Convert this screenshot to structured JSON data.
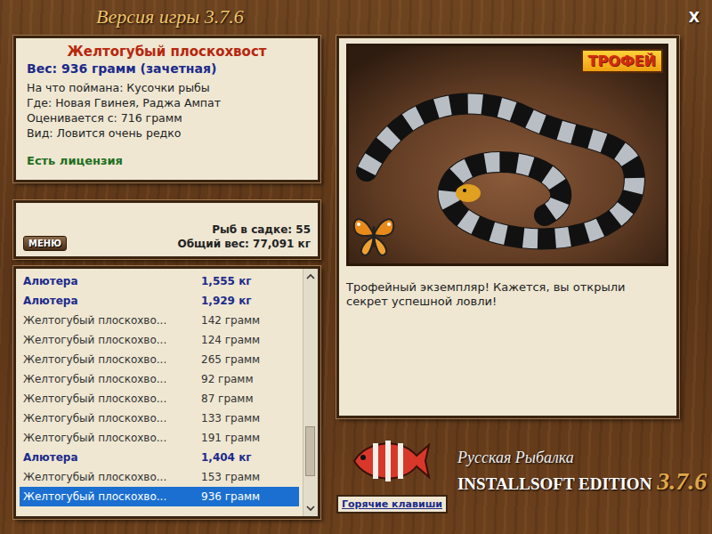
{
  "window": {
    "title": "Версия игры 3.7.6",
    "close": "X"
  },
  "catch": {
    "name": "Желтогубый плоскохвост",
    "weight": "Вес: 936 грамм (зачетная)",
    "details": [
      "На что поймана: Кусочки рыбы",
      "Где: Новая Гвинея, Раджа Ампат",
      "Оценивается с: 716 грамм",
      "Вид: Ловится очень редко"
    ],
    "license": "Есть лицензия"
  },
  "keepnet": {
    "menu_button": "МЕНЮ",
    "count": "Рыб в садке: 55",
    "total": "Общий вес: 77,091 кг"
  },
  "list": [
    {
      "name": "Алютера",
      "weight": "1,555 кг",
      "highlighted": true,
      "selected": false
    },
    {
      "name": "Алютера",
      "weight": "1,929 кг",
      "highlighted": true,
      "selected": false
    },
    {
      "name": "Желтогубый плоскохво...",
      "weight": "142 грамм",
      "highlighted": false,
      "selected": false
    },
    {
      "name": "Желтогубый плоскохво...",
      "weight": "124 грамм",
      "highlighted": false,
      "selected": false
    },
    {
      "name": "Желтогубый плоскохво...",
      "weight": "265 грамм",
      "highlighted": false,
      "selected": false
    },
    {
      "name": "Желтогубый плоскохво...",
      "weight": "92 грамм",
      "highlighted": false,
      "selected": false
    },
    {
      "name": "Желтогубый плоскохво...",
      "weight": "87 грамм",
      "highlighted": false,
      "selected": false
    },
    {
      "name": "Желтогубый плоскохво...",
      "weight": "133 грамм",
      "highlighted": false,
      "selected": false
    },
    {
      "name": "Желтогубый плоскохво...",
      "weight": "191 грамм",
      "highlighted": false,
      "selected": false
    },
    {
      "name": "Алютера",
      "weight": "1,404 кг",
      "highlighted": true,
      "selected": false
    },
    {
      "name": "Желтогубый плоскохво...",
      "weight": "153 грамм",
      "highlighted": false,
      "selected": false
    },
    {
      "name": "Желтогубый плоскохво...",
      "weight": "936 грамм",
      "highlighted": false,
      "selected": true
    }
  ],
  "scrollbar": {
    "level": 0.97
  },
  "photo": {
    "badge": "ТРОФЕЙ"
  },
  "message": "Трофейный экземпляр! Кажется, вы открыли секрет успешной ловли!",
  "logo": {
    "title": "Русская Рыбалка",
    "edition": "INSTALLSOFT EDITION",
    "version": "3.7.6"
  },
  "hotkeys_button": "Горячие клавиши"
}
